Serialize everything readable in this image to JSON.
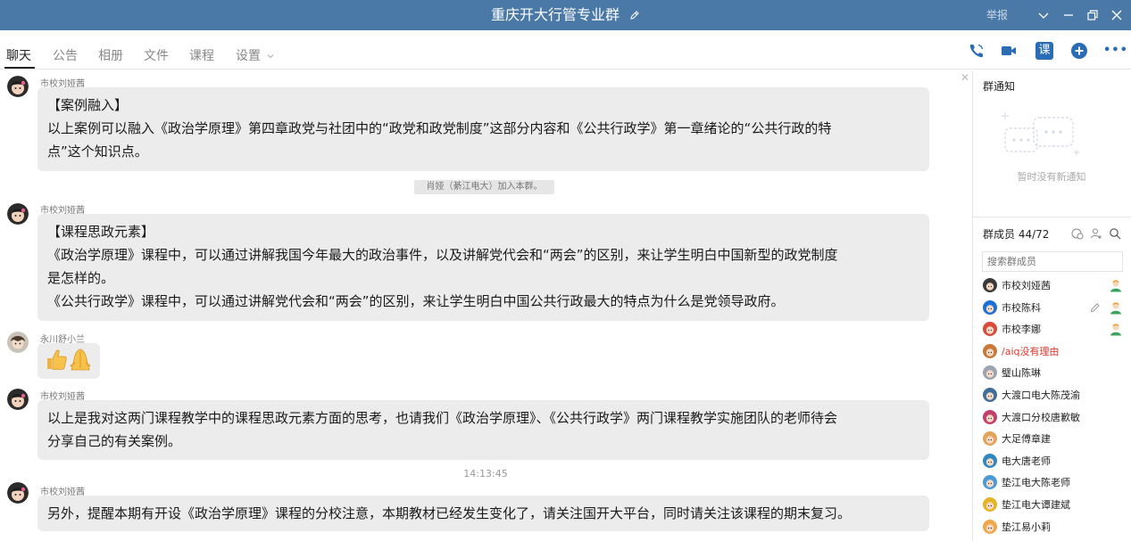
{
  "window": {
    "title": "重庆开大行管专业群",
    "report_label": "举报"
  },
  "tabs": [
    {
      "label": "聊天",
      "active": true
    },
    {
      "label": "公告"
    },
    {
      "label": "相册"
    },
    {
      "label": "文件"
    },
    {
      "label": "课程"
    },
    {
      "label": "设置"
    }
  ],
  "toolbar_icons": [
    "phone-icon",
    "video-icon",
    "course-icon",
    "add-icon",
    "more-icon"
  ],
  "toolbar": {
    "course_glyph": "课",
    "more_glyph": "•••"
  },
  "messages": [
    {
      "sender": "市校刘娅茜",
      "lines": [
        "【案例融入】",
        "以上案例可以融入《政治学原理》第四章政党与社团中的“政党和政党制度”这部分内容和《公共行政学》第一章绪论的“公共行政的特",
        "点”这个知识点。"
      ]
    },
    {
      "system": "肖娅（綦江电大）加入本群。"
    },
    {
      "sender": "市校刘娅茜",
      "lines": [
        "【课程思政元素】",
        "《政治学原理》课程中，可以通过讲解我国今年最大的政治事件，以及讲解党代会和“两会”的区别，来让学生明白中国新型的政党制度",
        "是怎样的。",
        "《公共行政学》课程中，可以通过讲解党代会和“两会”的区别，来让学生明白中国公共行政最大的特点为什么是党领导政府。"
      ]
    },
    {
      "sender": "永川舒小兰",
      "emoji": "👍🙏"
    },
    {
      "sender": "市校刘娅茜",
      "lines": [
        "以上是我对这两门课程教学中的课程思政元素方面的思考，也请我们《政治学原理》、《公共行政学》两门课程教学实施团队的老师待会",
        "分享自己的有关案例。"
      ]
    },
    {
      "timestamp": "14:13:45"
    },
    {
      "sender": "市校刘娅茜",
      "lines": [
        "另外，提醒本期有开设《政治学原理》课程的分校注意，本期教材已经发生变化了，请关注国开大平台，同时请关注该课程的期末复习。"
      ]
    }
  ],
  "sidebar": {
    "notice_title": "群通知",
    "notice_empty": "暂时没有新通知",
    "members_title": "群成员 44/72",
    "search_placeholder": "搜索群成员",
    "members": [
      {
        "name": "市校刘娅茜",
        "badge": true,
        "color": "#3a3a3a"
      },
      {
        "name": "市校陈科",
        "badge": true,
        "edit": true,
        "color": "#1d6fd6"
      },
      {
        "name": "市校李娜",
        "badge": true,
        "color": "#d84a3a"
      },
      {
        "name": "/aiq没有理由",
        "red": true,
        "color": "#c77a3a"
      },
      {
        "name": "璧山陈琳",
        "color": "#9aa4b2"
      },
      {
        "name": "大渡口电大陈茂渝",
        "color": "#3f6e9a"
      },
      {
        "name": "大渡口分校唐歉敏",
        "color": "#c23f6a"
      },
      {
        "name": "大足傅章建",
        "color": "#e2a35b"
      },
      {
        "name": "电大唐老师",
        "color": "#2f87c2"
      },
      {
        "name": "垫江电大陈老师",
        "color": "#4a9bd6"
      },
      {
        "name": "垫江电大谭建斌",
        "color": "#e6b422"
      },
      {
        "name": "垫江易小莉",
        "color": "#f0a94a"
      }
    ]
  },
  "colors": {
    "titlebar": "#4a79a7",
    "bubble": "#ececec",
    "accent_blue": "#2a6db5",
    "badge_green": "#3aa55a",
    "red_name": "#e0352b"
  }
}
